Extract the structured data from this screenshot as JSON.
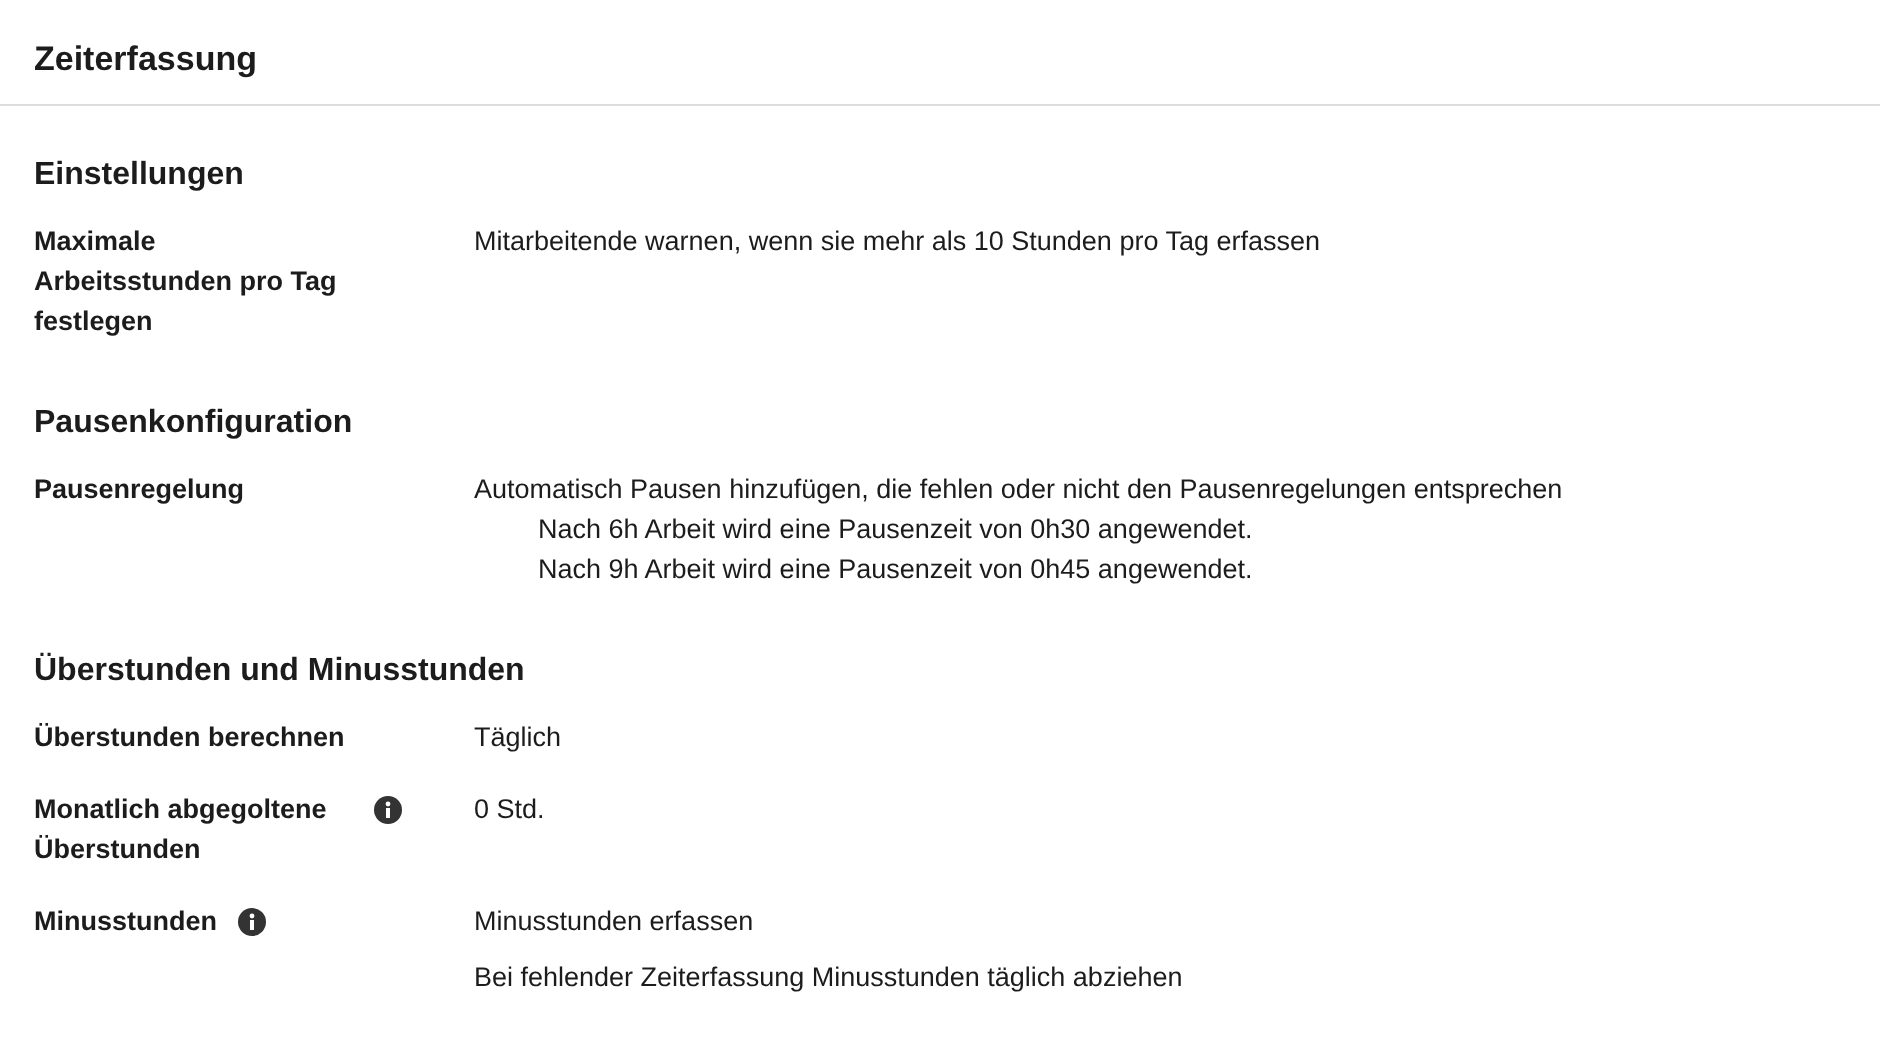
{
  "title": "Zeiterfassung",
  "sections": [
    {
      "heading": "Einstellungen",
      "rows": [
        {
          "label": "Maximale Arbeitsstunden pro Tag festlegen",
          "info_icon": false,
          "values": [
            {
              "text": "Mitarbeitende warnen, wenn sie mehr als 10 Stunden pro Tag erfassen"
            }
          ]
        }
      ]
    },
    {
      "heading": "Pausenkonfiguration",
      "rows": [
        {
          "label": "Pausenregelung",
          "info_icon": false,
          "values": [
            {
              "text": "Automatisch Pausen hinzufügen, die fehlen oder nicht den Pausenregelungen entsprechen",
              "children": [
                {
                  "text": "Nach 6h Arbeit wird eine Pausenzeit von 0h30 angewendet."
                },
                {
                  "text": "Nach 9h Arbeit wird eine Pausenzeit von 0h45 angewendet."
                }
              ]
            }
          ]
        }
      ]
    },
    {
      "heading": "Überstunden und Minusstunden",
      "rows": [
        {
          "label": "Überstunden berechnen",
          "info_icon": false,
          "values": [
            {
              "text": "Täglich"
            }
          ]
        },
        {
          "label": "Monatlich abgegoltene Überstunden",
          "info_icon": true,
          "values": [
            {
              "text": "0 Std."
            }
          ]
        },
        {
          "label": "Minusstunden",
          "info_icon": true,
          "values": [
            {
              "text": "Minusstunden erfassen"
            },
            {
              "text": "Bei fehlender Zeiterfassung Minusstunden täglich abziehen"
            }
          ]
        }
      ]
    }
  ]
}
